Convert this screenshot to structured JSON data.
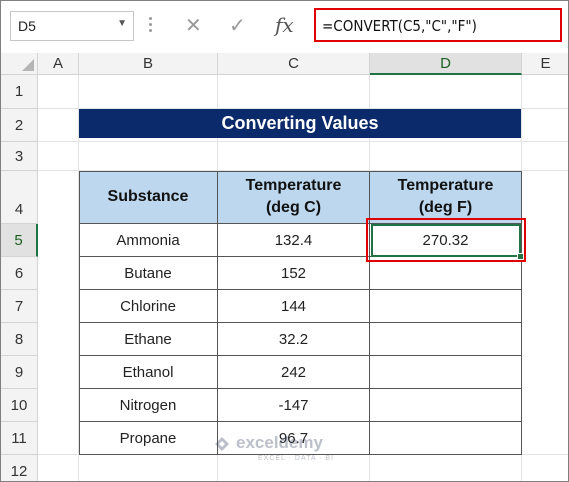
{
  "formula_bar": {
    "name_box": "D5",
    "formula": "=CONVERT(C5,\"C\",\"F\")",
    "cancel_icon": "close-icon",
    "enter_icon": "check-icon",
    "fx_label": "fx"
  },
  "columns": [
    "A",
    "B",
    "C",
    "D",
    "E"
  ],
  "selected_column": "D",
  "rows": [
    "1",
    "2",
    "3",
    "4",
    "5",
    "6",
    "7",
    "8",
    "9",
    "10",
    "11",
    "12"
  ],
  "selected_row": "5",
  "sheet": {
    "title": "Converting Values",
    "headers": {
      "substance": "Substance",
      "temp_c": "Temperature (deg C)",
      "temp_f": "Temperature (deg F)"
    },
    "data_rows": [
      {
        "substance": "Ammonia",
        "c": "132.4",
        "f": "270.32"
      },
      {
        "substance": "Butane",
        "c": "152",
        "f": ""
      },
      {
        "substance": "Chlorine",
        "c": "144",
        "f": ""
      },
      {
        "substance": "Ethane",
        "c": "32.2",
        "f": ""
      },
      {
        "substance": "Ethanol",
        "c": "242",
        "f": ""
      },
      {
        "substance": "Nitrogen",
        "c": "-147",
        "f": ""
      },
      {
        "substance": "Propane",
        "c": "96.7",
        "f": ""
      }
    ]
  },
  "watermark": {
    "name": "exceldemy",
    "tagline": "EXCEL · DATA · BI"
  },
  "colors": {
    "title_bg": "#0b2a6b",
    "header_bg": "#bdd7ee",
    "highlight": "#e00000",
    "selection": "#217346"
  }
}
